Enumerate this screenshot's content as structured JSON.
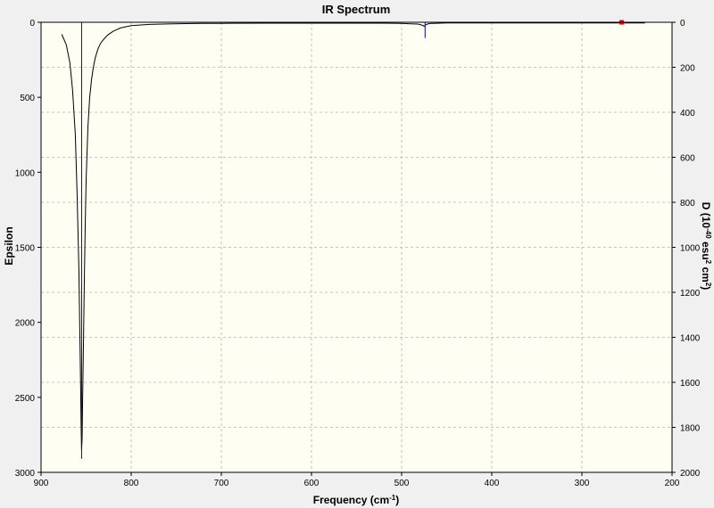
{
  "chart_data": {
    "type": "line",
    "title": "IR Spectrum",
    "xlabel": "Frequency (cm",
    "xlabel_sup": "-1",
    "xlabel_end": ")",
    "ylabel_left": "Epsilon",
    "ylabel_right_parts": [
      "D (10",
      "-40",
      " esu",
      "2",
      " cm",
      "2",
      ")"
    ],
    "xlim": [
      900,
      200
    ],
    "ylim_left": [
      0,
      3000
    ],
    "ylim_right": [
      0,
      2000
    ],
    "left_axis_inverted": true,
    "right_axis_inverted": true,
    "grid": true,
    "x_ticks": [
      900,
      800,
      700,
      600,
      500,
      400,
      300,
      200
    ],
    "y_ticks_left": [
      0,
      500,
      1000,
      1500,
      2000,
      2500,
      3000
    ],
    "y_ticks_right": [
      0,
      200,
      400,
      600,
      800,
      1000,
      1200,
      1400,
      1600,
      1800,
      2000
    ],
    "series": [
      {
        "style": "curve",
        "x": [
          877,
          872,
          868,
          865,
          862,
          860,
          858,
          857,
          856,
          855.5,
          855,
          854.5,
          854,
          853,
          852,
          851,
          850,
          848,
          846,
          844,
          842,
          840,
          837,
          834,
          830,
          826,
          820,
          812,
          800,
          780,
          760,
          740,
          720,
          700,
          650,
          600,
          560,
          540,
          520,
          500,
          490,
          482,
          478,
          476,
          475,
          474,
          473,
          471,
          468,
          464,
          458,
          450,
          420,
          380,
          340,
          300,
          270,
          256,
          240,
          230
        ],
        "y": [
          80,
          150,
          270,
          450,
          750,
          1150,
          1650,
          2050,
          2450,
          2700,
          2850,
          2780,
          2550,
          2150,
          1720,
          1350,
          1050,
          700,
          500,
          380,
          300,
          240,
          180,
          140,
          110,
          85,
          60,
          38,
          22,
          14,
          11,
          9,
          8,
          7,
          6,
          6,
          6,
          6,
          6,
          8,
          10,
          12,
          18,
          22,
          28,
          22,
          16,
          11,
          8,
          7,
          6,
          5,
          5,
          5,
          5,
          5,
          5,
          5,
          5,
          5
        ]
      },
      {
        "style": "sticks",
        "x": [
          855,
          474,
          256
        ],
        "y": [
          1940,
          70,
          3
        ]
      }
    ],
    "colors": {
      "plot_bg": "#fefef2",
      "grid": "#b4b4b4",
      "curve": "#000000",
      "sticks": "#0000e0",
      "marker": "#ff0000",
      "window_bg": "#f0f0f0"
    }
  }
}
